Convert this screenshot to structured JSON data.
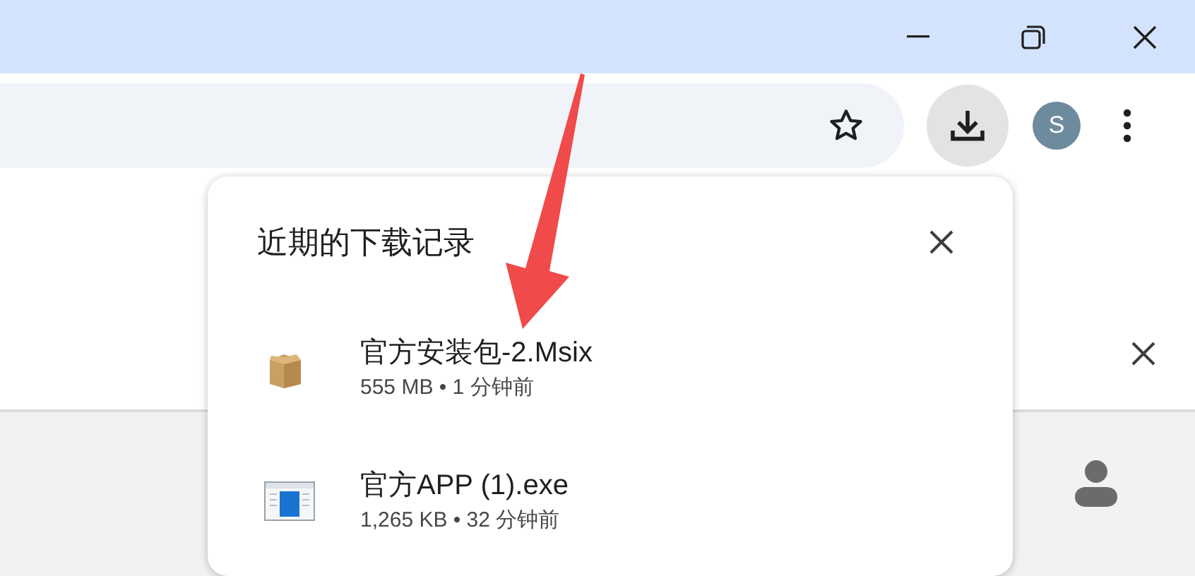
{
  "toolbar": {
    "avatar_letter": "S"
  },
  "downloads_panel": {
    "title": "近期的下载记录",
    "items": [
      {
        "kind": "package",
        "name": "官方安装包-2.Msix",
        "details": "555 MB • 1 分钟前"
      },
      {
        "kind": "app",
        "name": "官方APP (1).exe",
        "details": "1,265 KB • 32 分钟前"
      }
    ]
  }
}
